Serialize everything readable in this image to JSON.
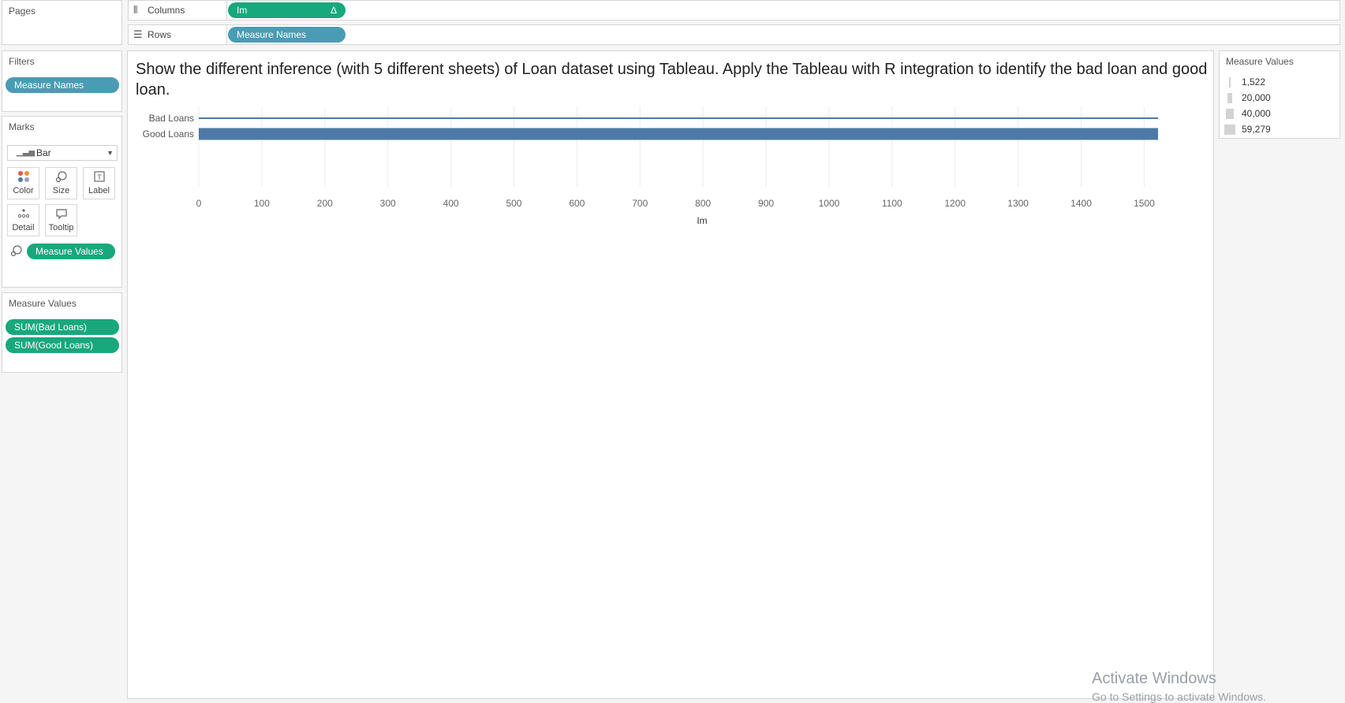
{
  "pages_card": {
    "title": "Pages"
  },
  "filters_card": {
    "title": "Filters",
    "pill": "Measure Names"
  },
  "marks_card": {
    "title": "Marks",
    "mark_type": "Bar",
    "buttons": [
      "Color",
      "Size",
      "Label",
      "Detail",
      "Tooltip"
    ],
    "size_pill": "Measure Values"
  },
  "measure_values_card": {
    "title": "Measure Values",
    "pills": [
      "SUM(Bad Loans)",
      "SUM(Good Loans)"
    ]
  },
  "columns_shelf": {
    "label": "Columns",
    "pill": "Im",
    "pill_symbol": "Δ"
  },
  "rows_shelf": {
    "label": "Rows",
    "pill": "Measure Names"
  },
  "sheet_title": "Show the different inference (with 5 different sheets) of Loan dataset using Tableau. Apply the Tableau with R integration to identify the bad loan and good loan.",
  "chart_data": {
    "type": "bar",
    "orientation": "horizontal",
    "categories": [
      "Bad Loans",
      "Good Loans"
    ],
    "values": [
      1522,
      1522
    ],
    "sizes": [
      1522,
      59279
    ],
    "xlabel": "Im",
    "xlim": [
      0,
      1522
    ],
    "x_ticks": [
      "0",
      "100",
      "200",
      "300",
      "400",
      "500",
      "600",
      "700",
      "800",
      "900",
      "1000",
      "1100",
      "1200",
      "1300",
      "1400",
      "1500"
    ],
    "gridlines": true,
    "bar_color": "#4e79a7"
  },
  "legend": {
    "title": "Measure Values",
    "items": [
      "1,522",
      "20,000",
      "40,000",
      "59,279"
    ],
    "item_values": [
      1522,
      20000,
      40000,
      59279
    ]
  },
  "watermark": {
    "line1": "Activate Windows",
    "line2": "Go to Settings to activate Windows."
  }
}
